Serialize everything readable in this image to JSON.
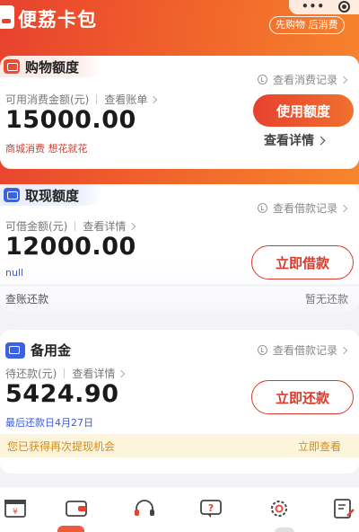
{
  "app": {
    "title": "便荔卡包",
    "slogan": "先购物 后消费",
    "capsule_more": "•••"
  },
  "shopping": {
    "tab_title": "购物额度",
    "record_link": "查看消费记录",
    "available_label": "可用消费金额(元)",
    "bill_link": "查看账单",
    "amount": "15000.00",
    "promo_text": "商城消费  想花就花",
    "use_button": "使用额度",
    "detail_link": "查看详情"
  },
  "cash": {
    "tab_title": "取现额度",
    "record_link": "查看借款记录",
    "available_label": "可借金额(元)",
    "detail_link": "查看详情",
    "amount": "12000.00",
    "note": "null",
    "borrow_button": "立即借款",
    "footer_left": "查账还款",
    "footer_right": "暂无还款"
  },
  "reserve": {
    "title": "备用金",
    "record_link": "查看借款记录",
    "pending_label": "待还款(元)",
    "detail_link": "查看详情",
    "amount": "5424.90",
    "due_text": "最后还款日4月27日",
    "repay_button": "立即还款",
    "notice_text": "您已获得再次提现机会",
    "notice_action": "立即查看"
  },
  "colors": {
    "brand_red": "#e8412e",
    "brand_orange": "#f6862c",
    "promo_red": "#d83a2b",
    "due_blue": "#3a5bd9",
    "notice_orange": "#d68b1c"
  },
  "tabbar": {
    "icons": [
      "yuan-box-icon",
      "wallet-icon",
      "headset-icon",
      "help-chat-icon",
      "gear-icon",
      "document-edit-icon"
    ]
  }
}
